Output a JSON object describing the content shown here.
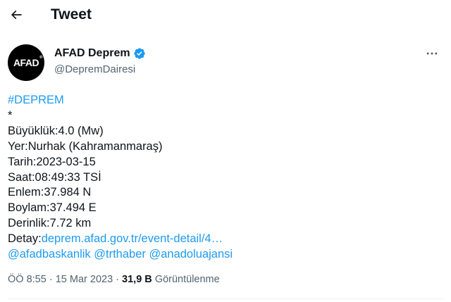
{
  "header": {
    "title": "Tweet",
    "back_icon": "arrow-left-icon"
  },
  "author": {
    "avatar_text": "AFAD",
    "display_name": "AFAD Deprem",
    "handle": "@DepremDairesi",
    "verified_color": "#1d9bf0"
  },
  "tweet": {
    "hashtag": "#DEPREM",
    "separator": "*",
    "lines": [
      "Büyüklük:4.0 (Mw)",
      "Yer:Nurhak (Kahramanmaraş)",
      "Tarih:2023-03-15",
      "Saat:08:49:33 TSİ",
      "Enlem:37.984 N",
      "Boylam:37.494 E",
      "Derinlik:7.72 km"
    ],
    "detail_label": "Detay:",
    "detail_link": "deprem.afad.gov.tr/event-detail/4…",
    "mentions": [
      "@afadbaskanlik",
      "@trthaber",
      "@anadoluajansi"
    ]
  },
  "meta": {
    "time": "ÖÖ 8:55",
    "dot1": "·",
    "date": "15 Mar 2023",
    "dot2": "·",
    "views_count": "31,9 B",
    "views_label": "Görüntülenme"
  },
  "colors": {
    "link": "#1d9bf0",
    "text": "#0f1419",
    "secondary": "#536471"
  }
}
